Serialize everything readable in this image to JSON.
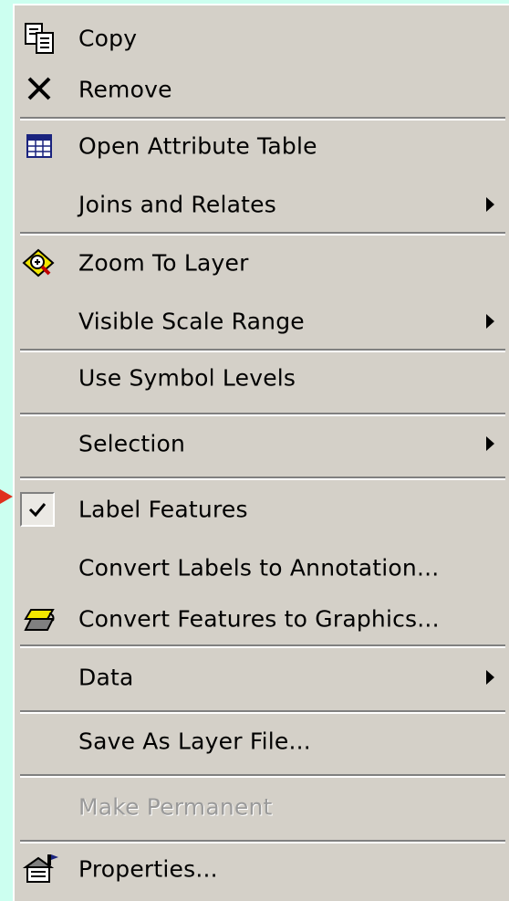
{
  "menu": {
    "items": [
      {
        "id": "copy",
        "label": "Copy",
        "icon": "copy-icon"
      },
      {
        "id": "remove",
        "label": "Remove",
        "icon": "remove-icon"
      },
      {
        "id": "open-attribute-table",
        "label": "Open Attribute Table",
        "icon": "table-icon"
      },
      {
        "id": "joins-and-relates",
        "label": "Joins and Relates",
        "submenu": true
      },
      {
        "id": "zoom-to-layer",
        "label": "Zoom To Layer",
        "icon": "zoom-layer-icon"
      },
      {
        "id": "visible-scale-range",
        "label": "Visible Scale Range",
        "submenu": true
      },
      {
        "id": "use-symbol-levels",
        "label": "Use Symbol Levels"
      },
      {
        "id": "selection",
        "label": "Selection",
        "submenu": true
      },
      {
        "id": "label-features",
        "label": "Label Features",
        "checked": true
      },
      {
        "id": "convert-labels",
        "label": "Convert Labels to Annotation..."
      },
      {
        "id": "convert-features",
        "label": "Convert Features to Graphics...",
        "icon": "convert-graphics-icon"
      },
      {
        "id": "data",
        "label": "Data",
        "submenu": true
      },
      {
        "id": "save-as-layer-file",
        "label": "Save As Layer File..."
      },
      {
        "id": "make-permanent",
        "label": "Make Permanent",
        "disabled": true
      },
      {
        "id": "properties",
        "label": "Properties...",
        "icon": "properties-icon"
      }
    ]
  },
  "colors": {
    "background": "#ccfff0",
    "menu_face": "#d4d0c8",
    "disabled_text": "#9a9a9a",
    "arrow": "#e0301e"
  }
}
